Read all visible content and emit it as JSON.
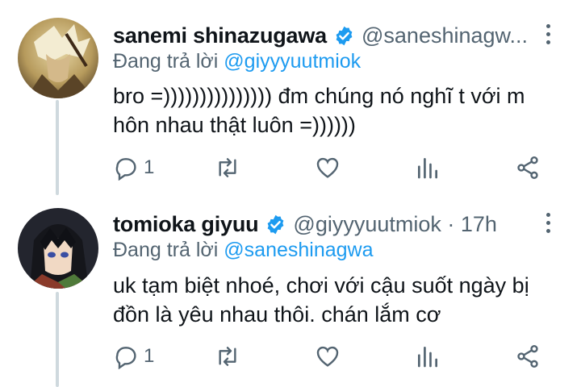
{
  "tweets": [
    {
      "display_name": "sanemi shinazugawa",
      "handle": "@saneshinagw...",
      "replying_prefix": "Đang trả lời",
      "replying_to": "@giyyyuutmiok",
      "text_line1": "bro =))))))))))))))) đm chúng nó nghĩ t với m",
      "text_line2": "hôn nhau thật luôn =))))))",
      "reply_count": "1",
      "icons": [
        "reply-icon",
        "retweet-icon",
        "like-icon",
        "analytics-icon",
        "share-icon"
      ]
    },
    {
      "display_name": "tomioka giyuu",
      "handle": "@giyyyuutmiok · 17h",
      "replying_prefix": "Đang trả lời",
      "replying_to": "@saneshinagwa",
      "text_line1": "uk tạm biệt nhoé, chơi với cậu suốt ngày bị",
      "text_line2": "đồn là yêu nhau thôi. chán lắm cơ",
      "reply_count": "1",
      "icons": [
        "reply-icon",
        "retweet-icon",
        "like-icon",
        "analytics-icon",
        "share-icon"
      ]
    }
  ],
  "colors": {
    "verified": "#1d9bf0",
    "mention": "#1d9bf0",
    "secondary_text": "#536471",
    "thread_line": "#cfd9de"
  }
}
